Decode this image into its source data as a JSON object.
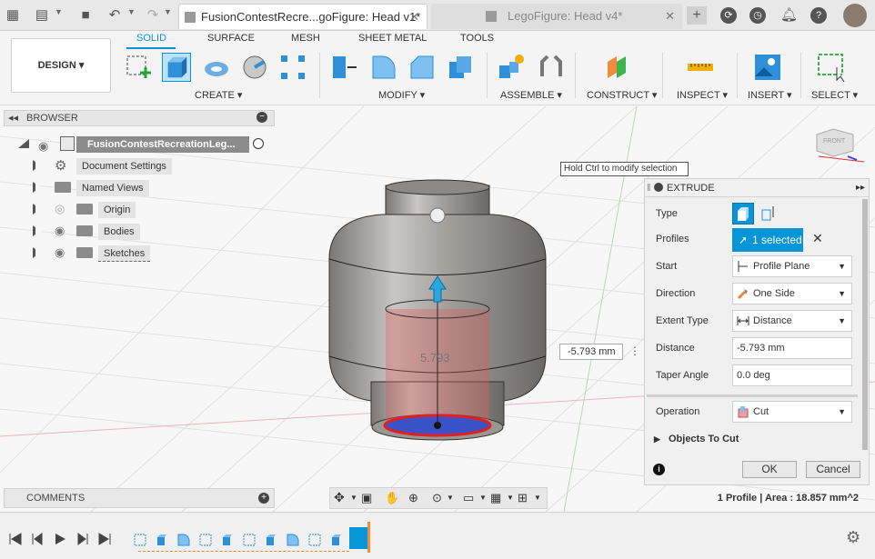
{
  "titlebar": {
    "tabs": [
      {
        "label": "FusionContestRecre...goFigure: Head v1*",
        "active": true
      },
      {
        "label": "LegoFigure: Head v4*",
        "active": false
      }
    ]
  },
  "toolbar": {
    "design_label": "DESIGN",
    "workspace_tabs": [
      "SOLID",
      "SURFACE",
      "MESH",
      "SHEET METAL",
      "TOOLS"
    ],
    "groups": [
      "CREATE",
      "MODIFY",
      "ASSEMBLE",
      "CONSTRUCT",
      "INSPECT",
      "INSERT",
      "SELECT"
    ]
  },
  "browser": {
    "title": "BROWSER",
    "root": "FusionContestRecreationLeg...",
    "items": [
      "Document Settings",
      "Named Views",
      "Origin",
      "Bodies",
      "Sketches"
    ]
  },
  "viewport": {
    "tooltip": "Hold Ctrl to modify selection",
    "dim_value": "-5.793 mm",
    "model_label": "5.793",
    "viewcube": "FRONT"
  },
  "extrude": {
    "title": "EXTRUDE",
    "type_label": "Type",
    "profiles_label": "Profiles",
    "profiles_value": "1 selected",
    "start_label": "Start",
    "start_value": "Profile Plane",
    "direction_label": "Direction",
    "direction_value": "One Side",
    "extent_label": "Extent Type",
    "extent_value": "Distance",
    "distance_label": "Distance",
    "distance_value": "-5.793 mm",
    "taper_label": "Taper Angle",
    "taper_value": "0.0 deg",
    "operation_label": "Operation",
    "operation_value": "Cut",
    "objects_label": "Objects To Cut",
    "ok_label": "OK",
    "cancel_label": "Cancel"
  },
  "bottom": {
    "comments_label": "COMMENTS",
    "status_text": "1 Profile | Area : 18.857 mm^2"
  },
  "colors": {
    "accent": "#0696d7",
    "cut_red": "#e05a5a"
  }
}
